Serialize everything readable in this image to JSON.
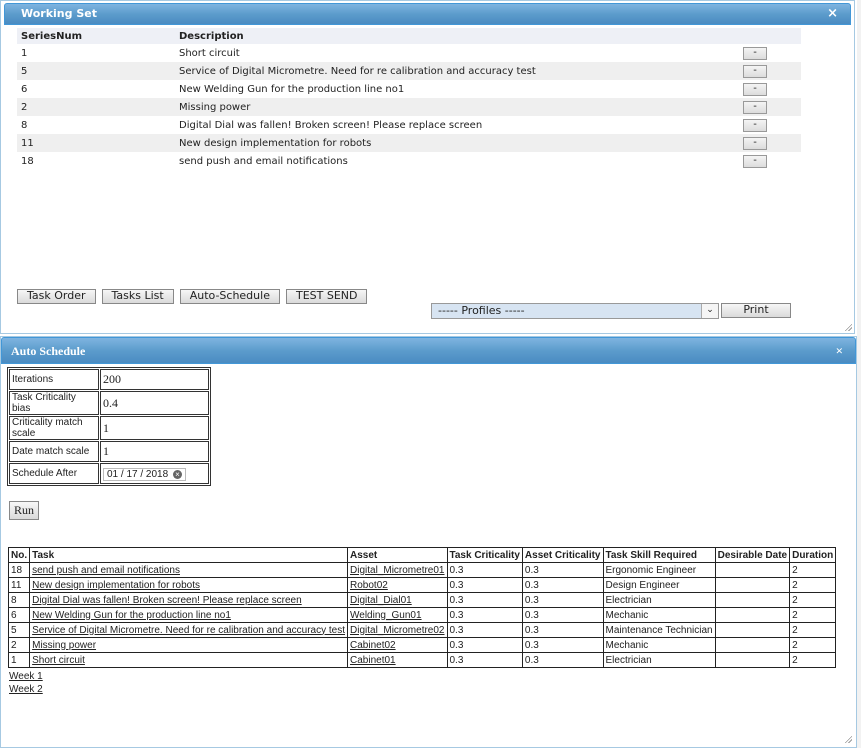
{
  "working_set": {
    "title": "Working Set",
    "close": "×",
    "columns": [
      "SeriesNum",
      "Description",
      ""
    ],
    "rows": [
      {
        "num": "1",
        "desc": "Short circuit",
        "btn": "-"
      },
      {
        "num": "5",
        "desc": "Service of Digital Micrometre. Need for re calibration and accuracy test",
        "btn": "-"
      },
      {
        "num": "6",
        "desc": "New Welding Gun for the production line no1",
        "btn": "-"
      },
      {
        "num": "2",
        "desc": "Missing power",
        "btn": "-"
      },
      {
        "num": "8",
        "desc": "Digital Dial was fallen! Broken screen! Please replace screen",
        "btn": "-"
      },
      {
        "num": "11",
        "desc": "New design implementation for robots",
        "btn": "-"
      },
      {
        "num": "18",
        "desc": "send push and email notifications",
        "btn": "-"
      }
    ],
    "buttons": {
      "task_order": "Task Order",
      "tasks_list": "Tasks List",
      "auto_schedule": "Auto-Schedule",
      "test_send": "TEST SEND"
    },
    "profiles_select": "----- Profiles -----",
    "print": "Print"
  },
  "auto_schedule": {
    "title": "Auto Schedule",
    "close": "×",
    "params": {
      "iterations_label": "Iterations",
      "iterations": "200",
      "bias_label": "Task Criticality bias",
      "bias": "0.4",
      "crit_scale_label": "Criticality match scale",
      "crit_scale": "1",
      "date_scale_label": "Date match scale",
      "date_scale": "1",
      "schedule_after_label": "Schedule After",
      "schedule_after": "01 / 17 / 2018"
    },
    "run": "Run",
    "table": {
      "headers": [
        "No.",
        "Task",
        "Asset",
        "Task Criticality",
        "Asset Criticality",
        "Task Skill Required",
        "Desirable Date",
        "Duration"
      ],
      "rows": [
        [
          "18",
          "send push and email notifications",
          "Digital_Micrometre01",
          "0.3",
          "0.3",
          "Ergonomic Engineer",
          "",
          "2"
        ],
        [
          "11",
          "New design implementation for robots",
          "Robot02",
          "0.3",
          "0.3",
          "Design Engineer",
          "",
          "2"
        ],
        [
          "8",
          "Digital Dial was fallen! Broken screen! Please replace screen",
          "Digital_Dial01",
          "0.3",
          "0.3",
          "Electrician",
          "",
          "2"
        ],
        [
          "6",
          "New Welding Gun for the production line no1",
          "Welding_Gun01",
          "0.3",
          "0.3",
          "Mechanic",
          "",
          "2"
        ],
        [
          "5",
          "Service of Digital Micrometre. Need for re calibration and accuracy test",
          "Digital_Micrometre02",
          "0.3",
          "0.3",
          "Maintenance Technician",
          "",
          "2"
        ],
        [
          "2",
          "Missing power",
          "Cabinet02",
          "0.3",
          "0.3",
          "Mechanic",
          "",
          "2"
        ],
        [
          "1",
          "Short circuit",
          "Cabinet01",
          "0.3",
          "0.3",
          "Electrician",
          "",
          "2"
        ]
      ]
    },
    "weeks": [
      "Week 1",
      "Week 2"
    ]
  }
}
